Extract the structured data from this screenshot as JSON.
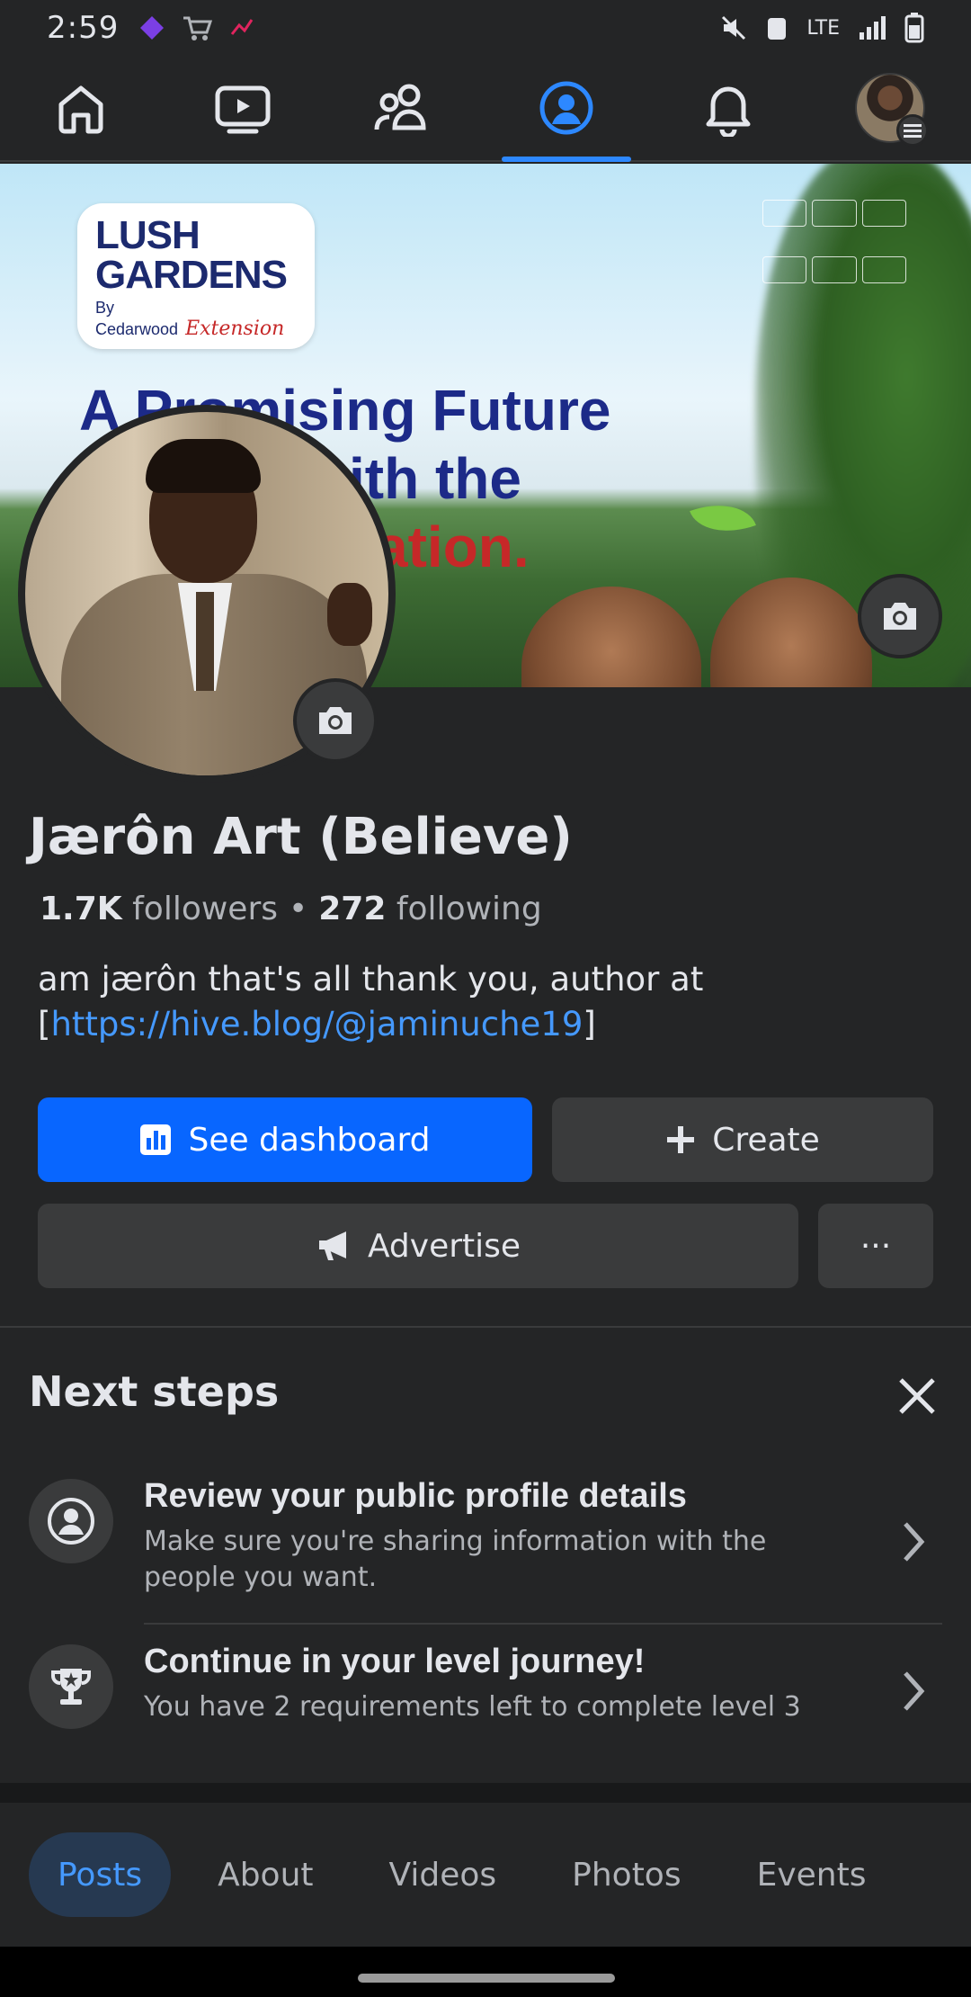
{
  "status_bar": {
    "time": "2:59",
    "network": "LTE"
  },
  "nav": {
    "tabs": [
      {
        "name": "home-icon"
      },
      {
        "name": "video-icon"
      },
      {
        "name": "friends-icon"
      },
      {
        "name": "profile-icon",
        "active": true
      },
      {
        "name": "bell-icon"
      },
      {
        "name": "account-avatar"
      }
    ],
    "active_color": "#2d88ff"
  },
  "cover": {
    "logo_line1": "LUSH",
    "logo_line2": "GARDENS",
    "logo_by": "By Cedarwood",
    "logo_extension": "Extension",
    "headline_line1": "A Promising Future",
    "headline_line2": "ith the",
    "headline_line3": "ation."
  },
  "profile": {
    "name": "Jærôn Art (Believe)",
    "followers_count": "1.7K",
    "followers_label": "followers",
    "following_count": "272",
    "following_label": "following",
    "bio_text": "am jærôn that's all thank you, author at",
    "bio_link": "https://hive.blog/@jaminuche19"
  },
  "actions": {
    "dashboard_label": "See dashboard",
    "create_label": "Create",
    "advertise_label": "Advertise",
    "more_label": "···"
  },
  "next_steps": {
    "title": "Next steps",
    "items": [
      {
        "title": "Review your public profile details",
        "description": "Make sure you're sharing information with the people you want."
      },
      {
        "title": "Continue in your level journey!",
        "description": "You have 2 requirements left to complete level 3"
      }
    ]
  },
  "profile_tabs": [
    {
      "label": "Posts",
      "active": true
    },
    {
      "label": "About"
    },
    {
      "label": "Videos"
    },
    {
      "label": "Photos"
    },
    {
      "label": "Events"
    }
  ],
  "colors": {
    "background": "#242526",
    "primary_button": "#0866ff",
    "link": "#4599ff"
  }
}
